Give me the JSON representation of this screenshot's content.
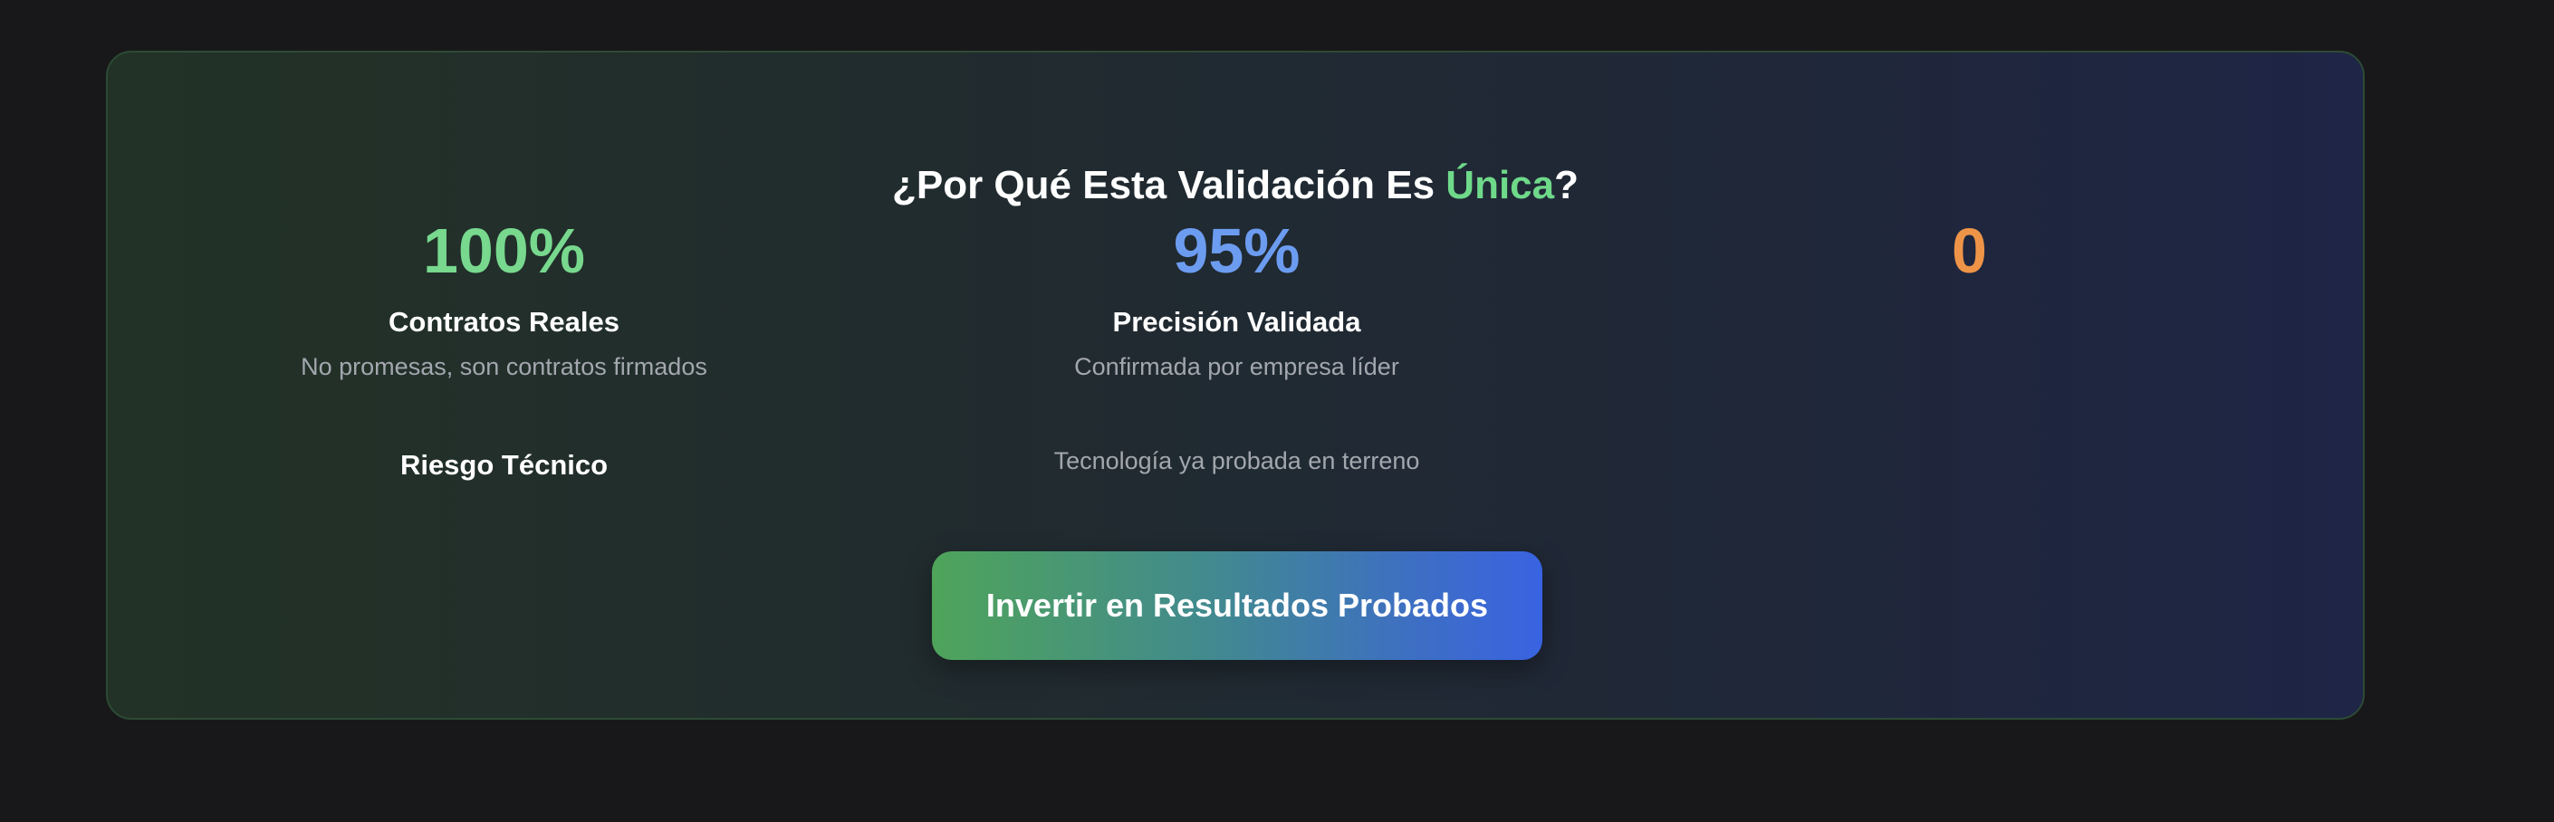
{
  "section": {
    "title_prefix": "¿Por Qué Esta Validación Es ",
    "title_highlight": "Única",
    "title_suffix": "?",
    "highlight_color": "#6fd98a"
  },
  "stats": [
    {
      "value": "100%",
      "color": "#77d88e",
      "label": "Contratos Reales",
      "description": "No promesas, son contratos firmados"
    },
    {
      "value": "95%",
      "color": "#6c9cf0",
      "label": "Precisión Validada",
      "description": "Confirmada por empresa líder"
    },
    {
      "value": "0",
      "color": "#ee9448",
      "label": "Riesgo Técnico",
      "description": "Tecnología ya probada en terreno"
    }
  ],
  "cta": {
    "label": "Invertir en Resultados Probados"
  }
}
